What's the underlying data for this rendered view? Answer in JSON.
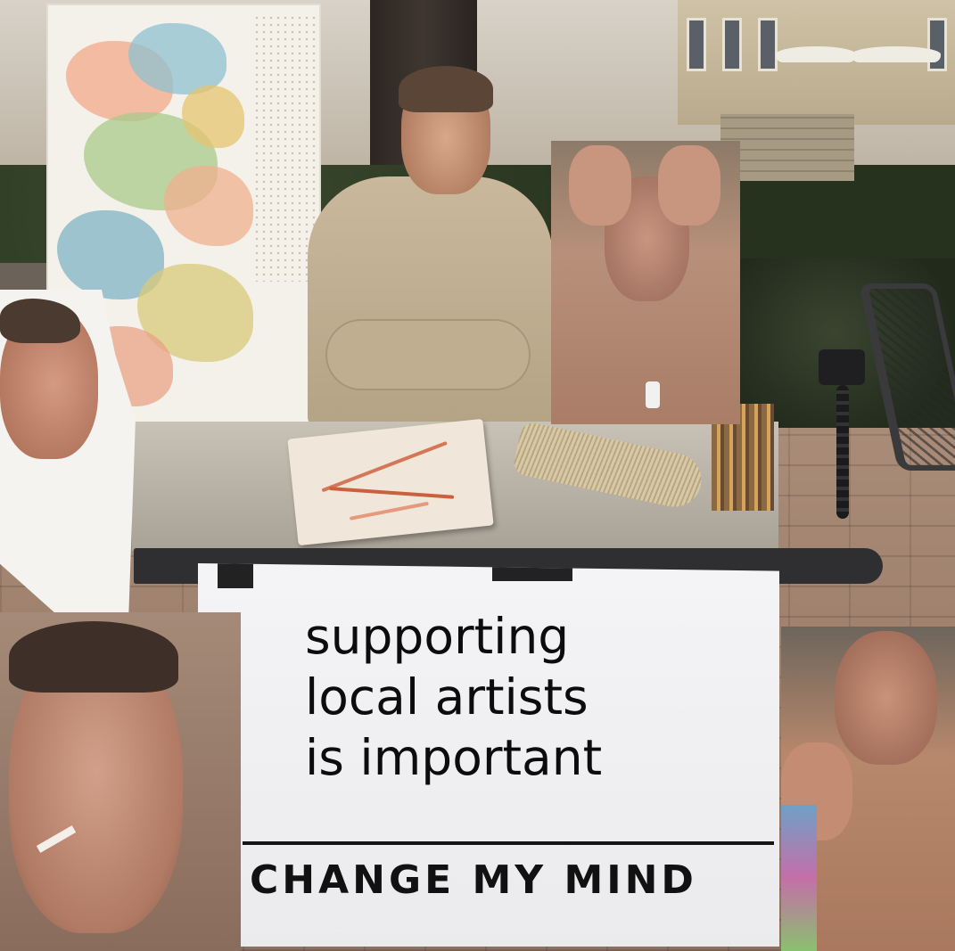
{
  "sign": {
    "headline": "supporting\nlocal artists\nis important",
    "tagline": "CHANGE MY MIND"
  },
  "palette": {
    "sign_paper": "#f4f4f6",
    "sign_ink": "#0c0c0c",
    "ground": "#9a7c68",
    "hedge": "#2d3a24",
    "shirt": "#c9b89c"
  }
}
